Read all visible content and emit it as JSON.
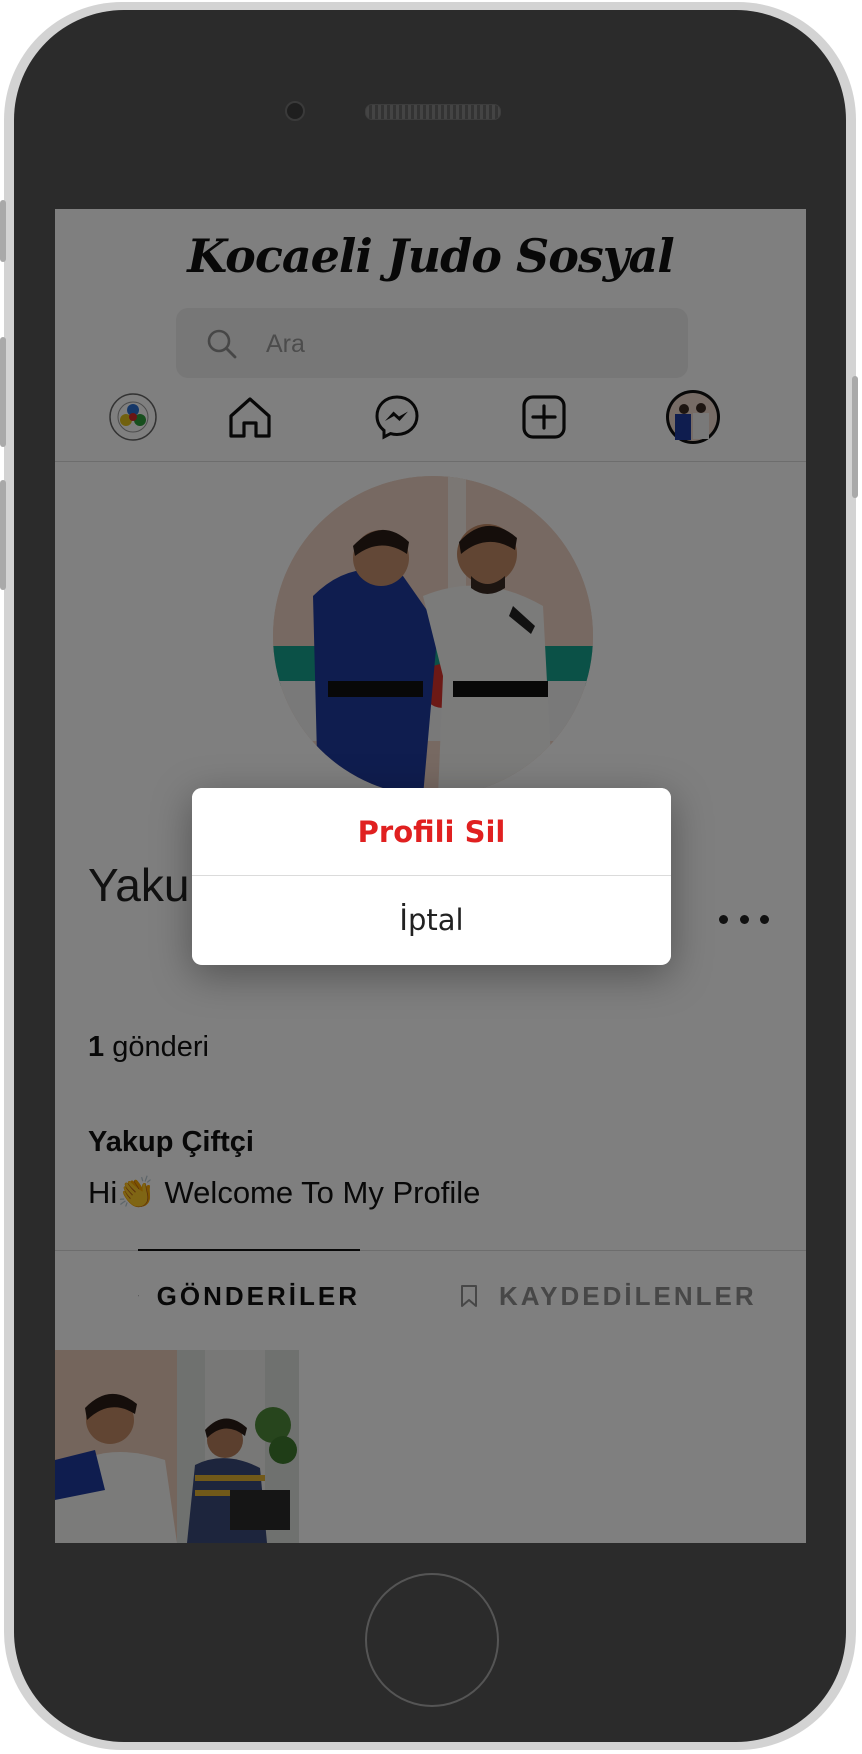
{
  "app": {
    "brand": "Kocaeli Judo Sosyal"
  },
  "search": {
    "placeholder": "Ara"
  },
  "nav": {
    "items": [
      "judo-logo",
      "home-icon",
      "messenger-icon",
      "add-post-icon",
      "avatar"
    ]
  },
  "profile": {
    "username": "Yakup Çiftçi",
    "post_count": "1",
    "post_label": "gönderi",
    "bio_name": "Yakup Çiftçi",
    "bio_text": "Hi👏 Welcome To My Profile"
  },
  "tabs": [
    {
      "label": "GÖNDERİLER",
      "icon": "grid-icon",
      "active": true
    },
    {
      "label": "KAYDEDİLENLER",
      "icon": "bookmark-icon",
      "active": false
    }
  ],
  "dialog": {
    "delete_label": "Profili Sil",
    "cancel_label": "İptal"
  },
  "colors": {
    "danger": "#e02020",
    "overlay": "rgba(0,0,0,0.5)",
    "judo_blue": "#1f3a9e",
    "phone_body": "#2b2b2b"
  }
}
